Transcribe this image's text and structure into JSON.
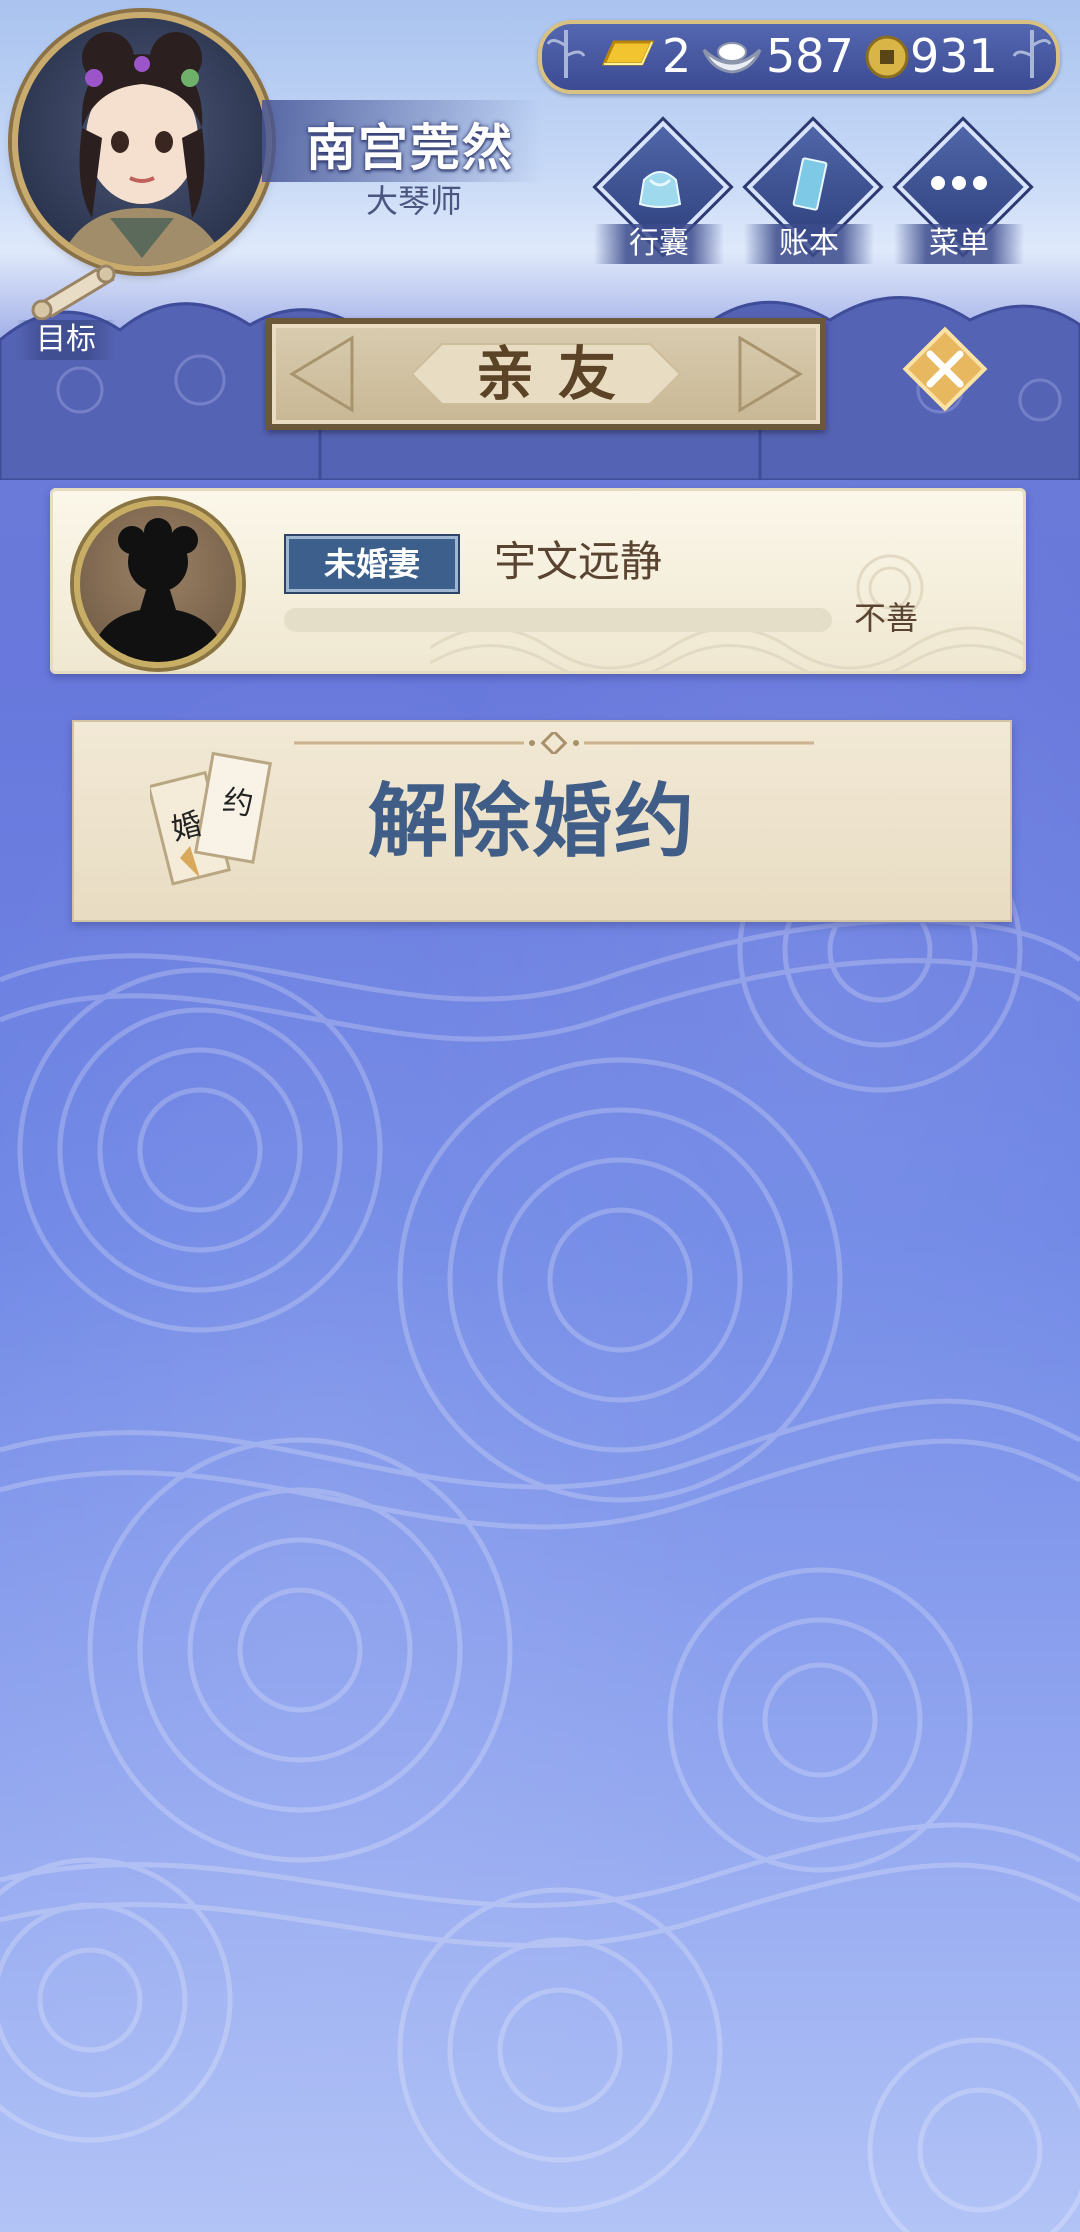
{
  "player": {
    "name": "南宫莞然",
    "title": "大琴师"
  },
  "currency": {
    "gold": "2",
    "silver": "587",
    "coins": "931"
  },
  "menu": {
    "bag_label": "行囊",
    "ledger_label": "账本",
    "menu_label": "菜单",
    "target_label": "目标"
  },
  "page": {
    "title": "亲友"
  },
  "friend": {
    "relation": "未婚妻",
    "name": "宇文远静",
    "affinity_label": "不善",
    "affinity_fraction": 0.0
  },
  "action": {
    "label": "解除婚约",
    "icon_text_1": "婚",
    "icon_text_2": "约"
  },
  "colors": {
    "accent_gold": "#d9c281",
    "badge_blue": "#3d5f8c",
    "action_text": "#3f5d86",
    "background_blue": "#6878dc"
  }
}
